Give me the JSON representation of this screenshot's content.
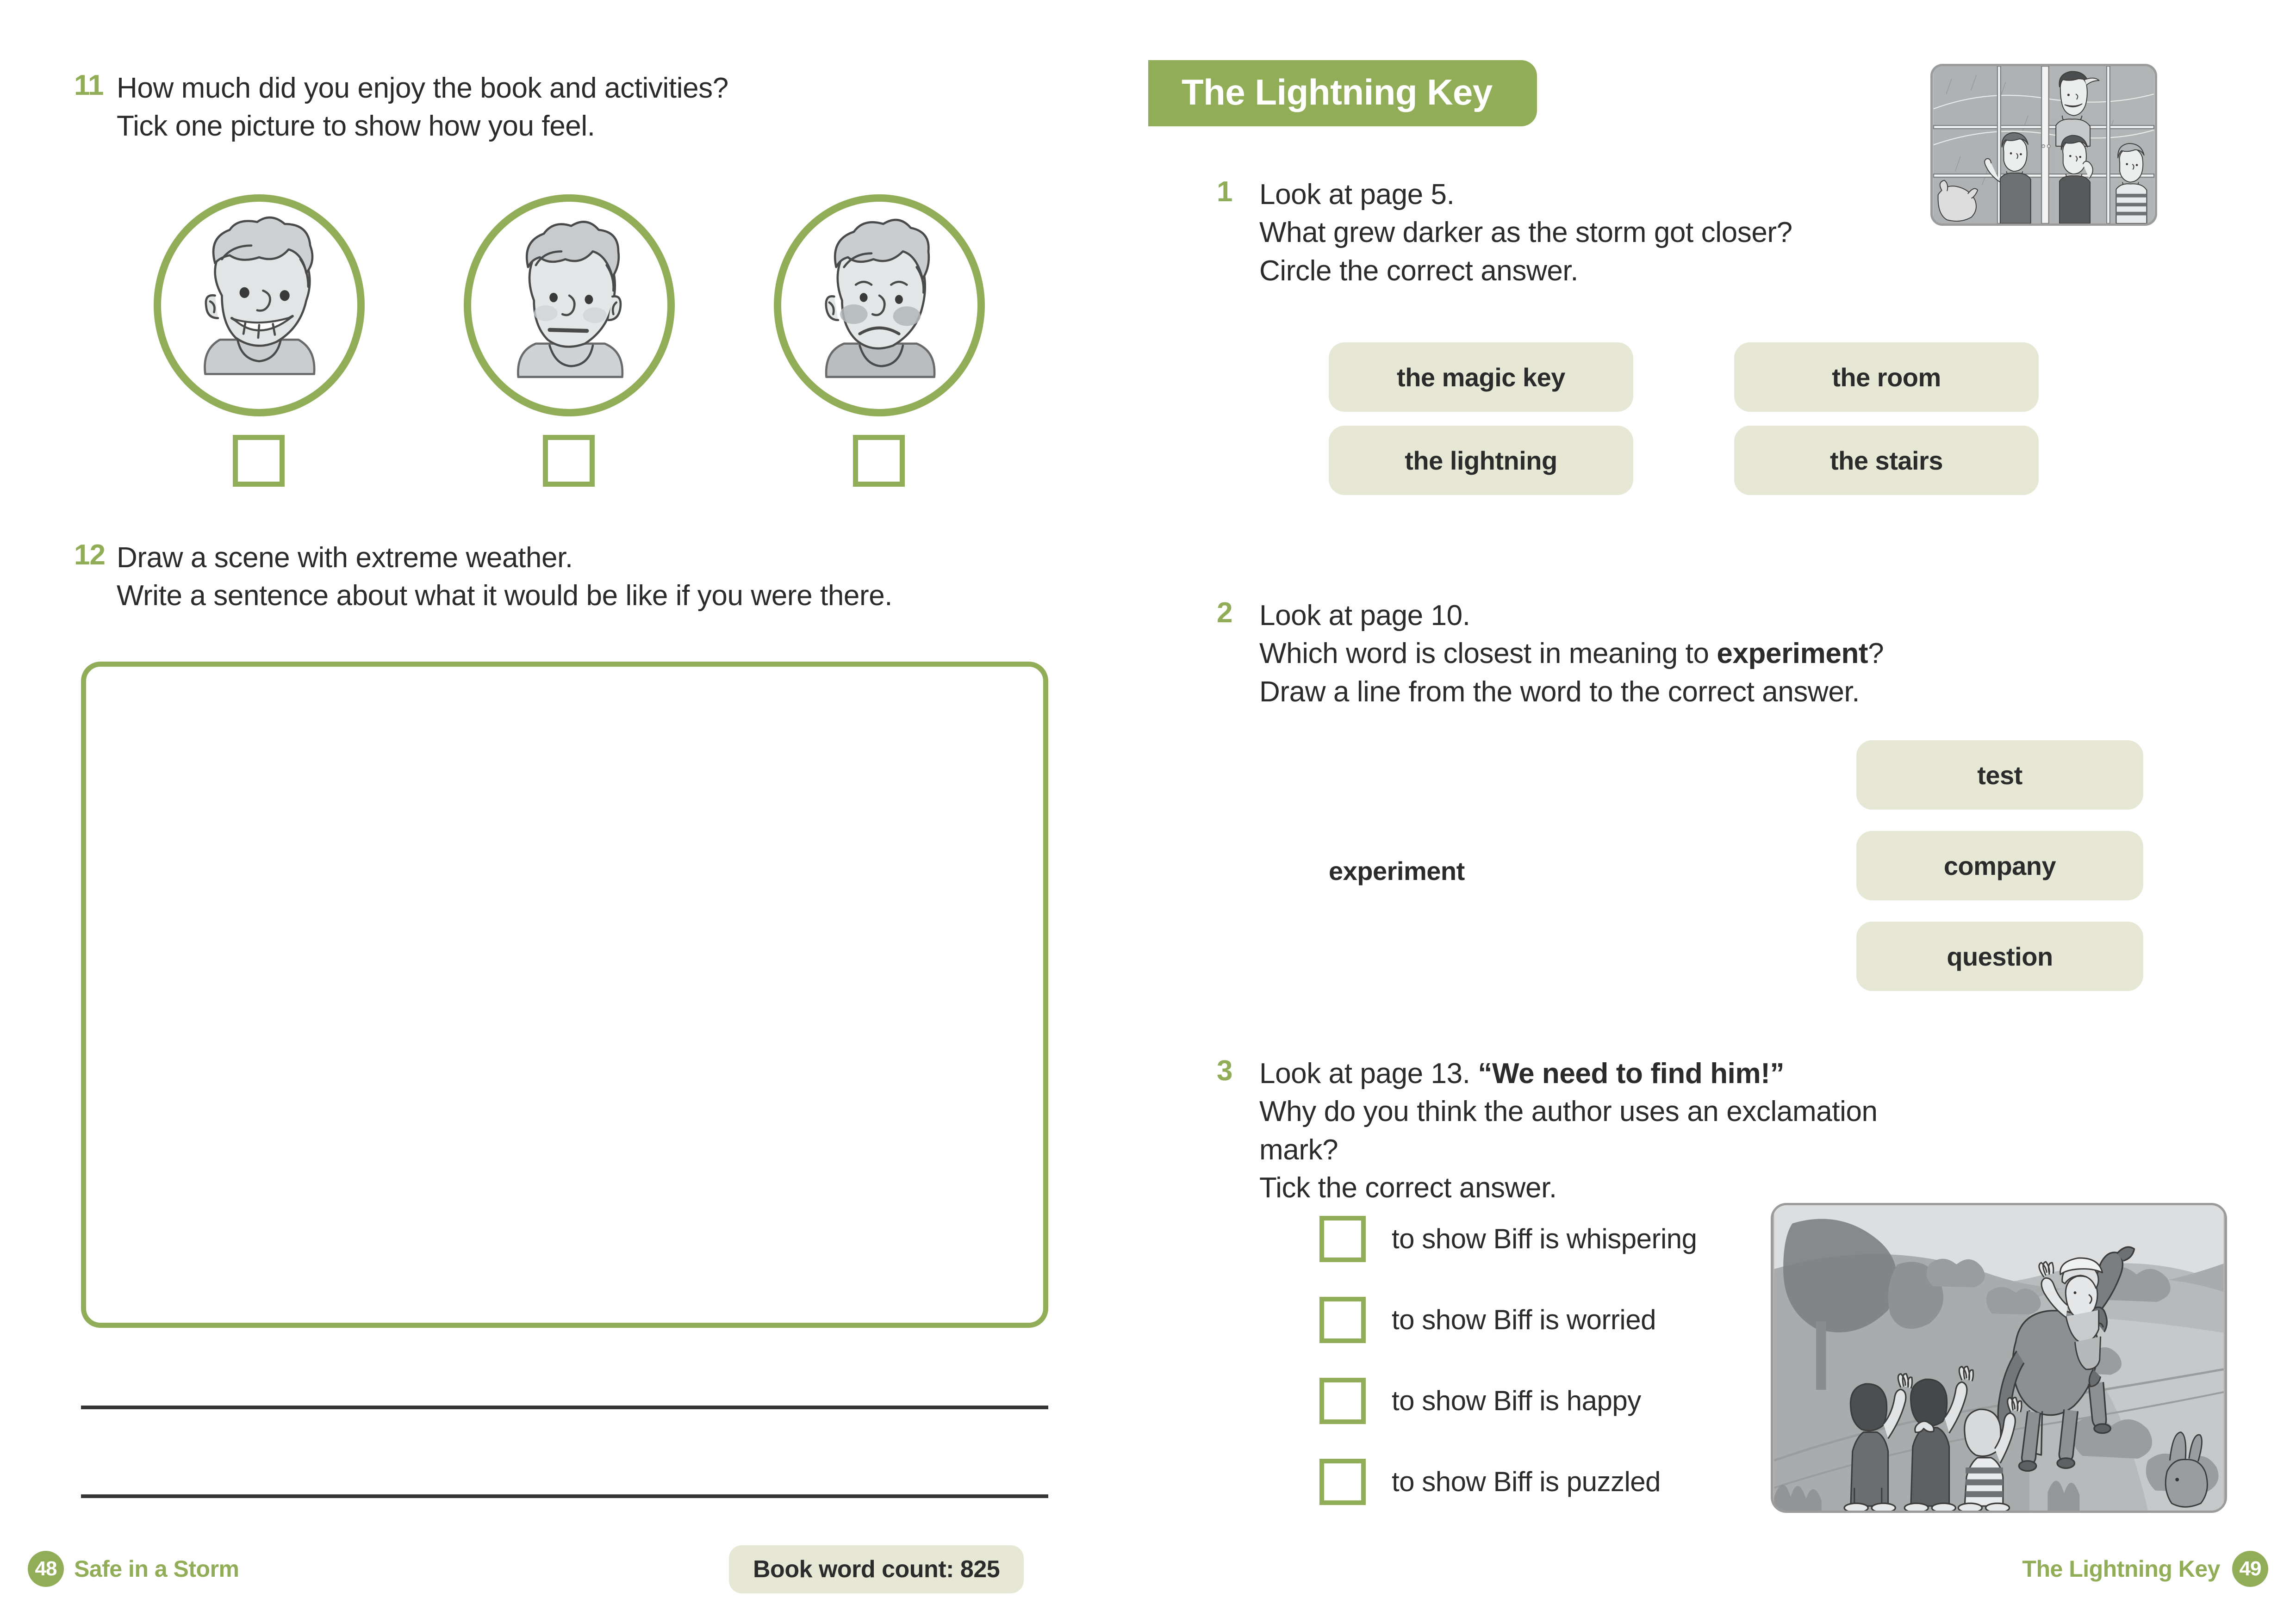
{
  "left_page": {
    "page_number": "48",
    "footer_title": "Safe in a Storm",
    "word_count_label": "Book word count: 825",
    "q11": {
      "number": "11",
      "line1": "How much did you enjoy the book and activities?",
      "line2": "Tick one picture to show how you feel."
    },
    "faces": [
      {
        "expression": "happy-face",
        "checkbox": ""
      },
      {
        "expression": "neutral-face",
        "checkbox": ""
      },
      {
        "expression": "sad-face",
        "checkbox": ""
      }
    ],
    "q12": {
      "number": "12",
      "line1": "Draw a scene with extreme weather.",
      "line2": "Write a sentence about what it would be like if you were there."
    },
    "drawing_box_value": "",
    "writing_lines": [
      "",
      ""
    ]
  },
  "right_page": {
    "header_title": "The Lightning Key",
    "page_number": "49",
    "footer_title": "The Lightning Key",
    "q1": {
      "number": "1",
      "line1": "Look at page 5.",
      "line2": "What grew darker as the storm got closer?",
      "line3": "Circle the correct answer.",
      "options": [
        "the magic key",
        "the room",
        "the lightning",
        "the stairs"
      ]
    },
    "q2": {
      "number": "2",
      "line1": "Look at page 10.",
      "line2_pre": "Which word is closest in meaning to ",
      "line2_bold": "experiment",
      "line2_post": "?",
      "line3": "Draw a line from the word to the correct answer.",
      "source_word": "experiment",
      "options": [
        "test",
        "company",
        "question"
      ]
    },
    "q3": {
      "number": "3",
      "line1_pre": "Look at page 13. ",
      "line1_bold": "“We need to find him!”",
      "line2": "Why do you think the author uses an exclamation mark?",
      "line3": "Tick the correct answer.",
      "options": [
        "to show Biff is whispering",
        "to show Biff is worried",
        "to show Biff is happy",
        "to show Biff is puzzled"
      ]
    },
    "illustration_top": "children-at-rainy-window-illustration",
    "illustration_bottom": "children-waving-at-horse-rider-illustration"
  },
  "colors": {
    "accent_green": "#92AD57",
    "pill_cream": "#E6E8D5",
    "text_dark": "#2b2b2b",
    "rule_dark": "#353535"
  }
}
